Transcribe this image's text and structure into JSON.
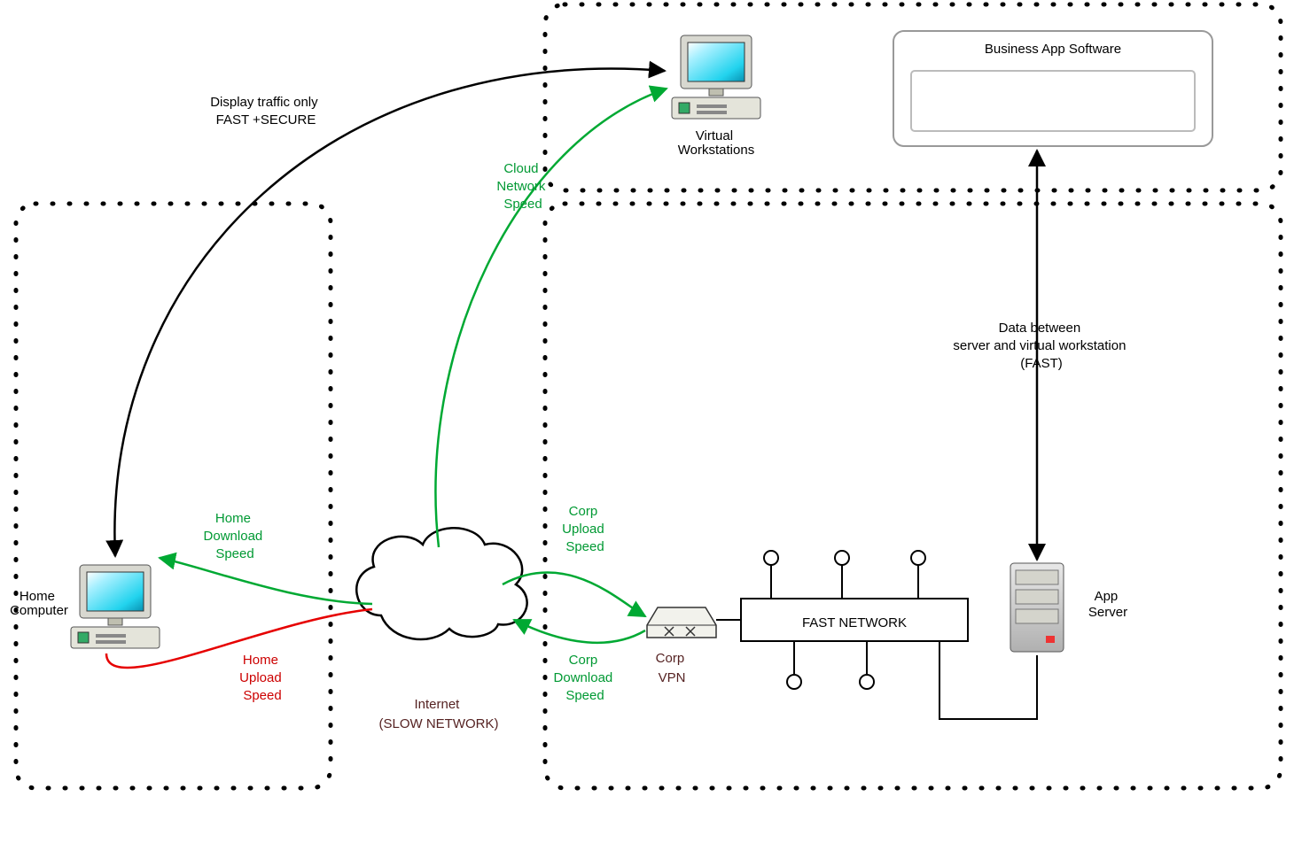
{
  "nodes": {
    "home_computer": "Home\nComputer",
    "virtual_workstations": "Virtual\nWorkstations",
    "business_app": "Business App Software",
    "app_server": "App\nServer",
    "fast_network": "FAST NETWORK",
    "corp_vpn": "Corp\nVPN",
    "internet": "Internet\n(SLOW NETWORK)"
  },
  "edges": {
    "display_traffic": "Display traffic only\nFAST +SECURE",
    "cloud_network_speed": "Cloud\nNetwork\nSpeed",
    "home_download": "Home\nDownload\nSpeed",
    "home_upload": "Home\nUpload\nSpeed",
    "corp_upload": "Corp\nUpload\nSpeed",
    "corp_download": "Corp\nDownload\nSpeed",
    "data_between": "Data between\nserver and virtual workstation\n(FAST)"
  },
  "colors": {
    "green": "#00a933",
    "red": "#e60000",
    "black": "#000000"
  }
}
